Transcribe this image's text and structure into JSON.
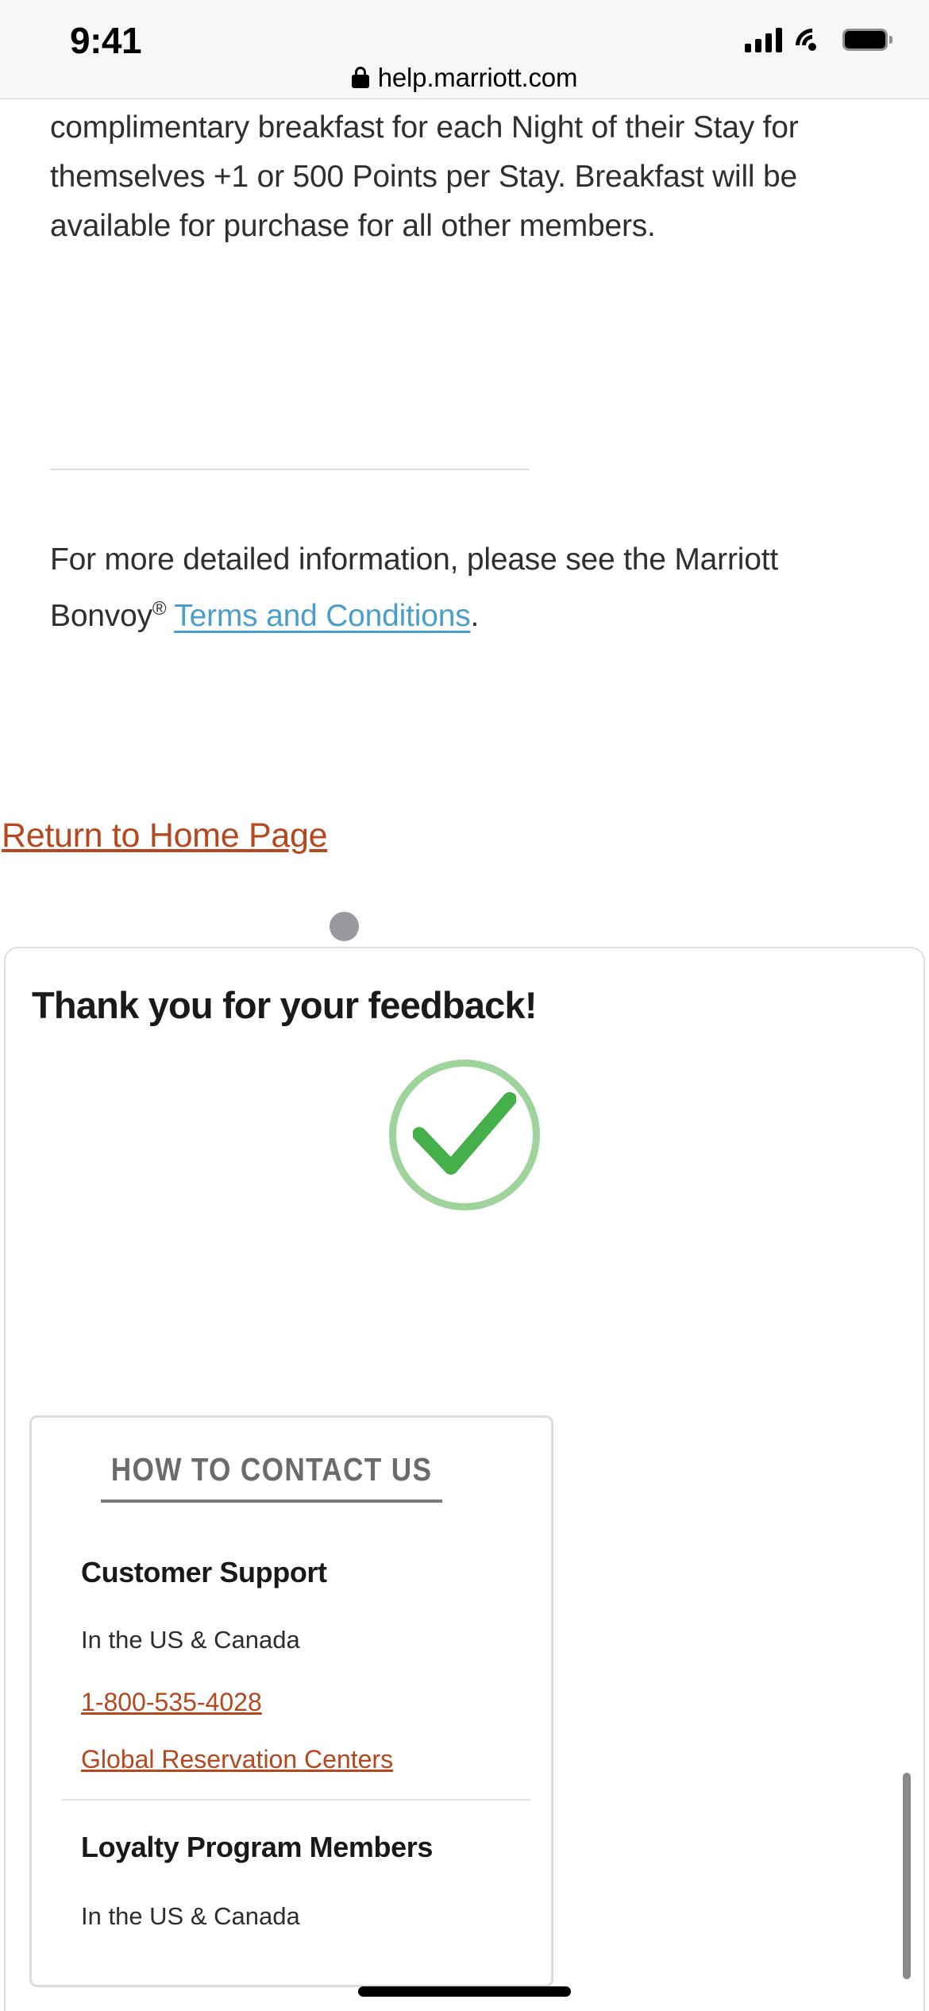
{
  "status_bar": {
    "time": "9:41",
    "cellular_icon": "cellular-bars-icon",
    "wifi_icon": "wifi-icon",
    "battery_icon": "battery-icon"
  },
  "browser": {
    "lock_icon": "lock-icon",
    "url": "help.marriott.com"
  },
  "article": {
    "paragraph_1": "complimentary breakfast for each Night of their Stay for themselves +1 or 500 Points per Stay. Breakfast will be available for purchase for all other members.",
    "paragraph_2_prefix": "For more detailed information, please see the Marriott Bonvoy",
    "registered_mark": "®",
    "terms_link": "Terms and Conditions",
    "paragraph_2_suffix": ".",
    "return_home_link": "Return to Home Page"
  },
  "sheet": {
    "drag_handle": "drag-handle",
    "title": "Thank you for your feedback!",
    "success_icon": "green-check-circle-icon",
    "contact_card": {
      "heading": "HOW TO CONTACT US",
      "sections": [
        {
          "title": "Customer Support",
          "region": "In the US & Canada",
          "phone": "1-800-535-4028",
          "link": "Global Reservation Centers"
        },
        {
          "title": "Loyalty Program Members",
          "region": "In the US & Canada"
        }
      ]
    }
  },
  "colors": {
    "link_orange": "#b5481f",
    "link_blue": "#4a9ecb",
    "success_green": "#45b04a",
    "success_ring": "#9ed49b",
    "heading_gray": "#6b6b6b"
  }
}
